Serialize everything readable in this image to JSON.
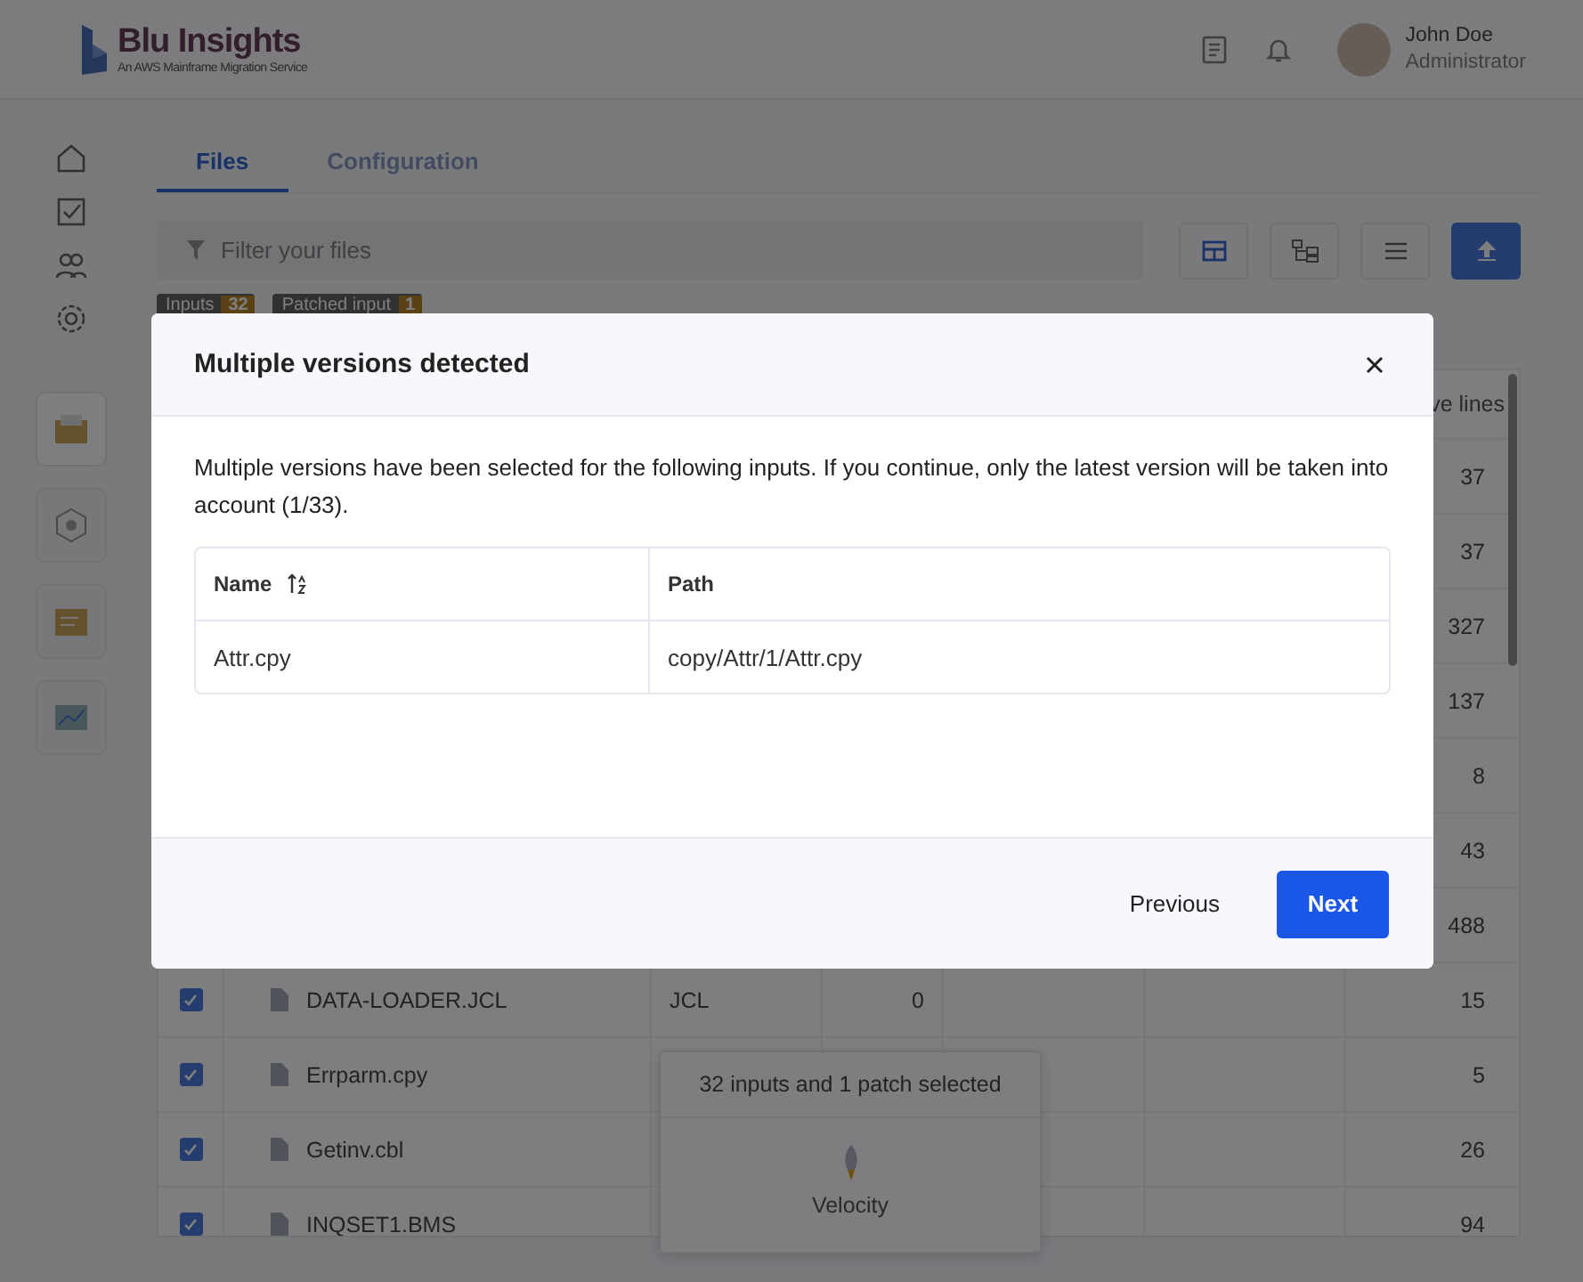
{
  "header": {
    "brand": "Blu Insights",
    "tagline": "An AWS Mainframe Migration Service",
    "user": {
      "name": "John Doe",
      "role": "Administrator"
    }
  },
  "tabs": [
    {
      "label": "Files",
      "selected": true
    },
    {
      "label": "Configuration",
      "selected": false
    }
  ],
  "filter": {
    "placeholder": "Filter your files"
  },
  "view_buttons": [
    {
      "kind": "table",
      "selected": true
    },
    {
      "kind": "tree",
      "selected": false
    }
  ],
  "badges": [
    {
      "label": "Inputs",
      "count": "32"
    },
    {
      "label": "Patched input",
      "count": "1"
    }
  ],
  "table": {
    "column_7": "ve lines",
    "rows": [
      {
        "lines": "37"
      },
      {
        "lines": "37"
      },
      {
        "lines": "327"
      },
      {
        "lines": "137"
      },
      {
        "lines": "8"
      },
      {
        "lines": "43"
      },
      {
        "lines": "488"
      },
      {
        "checked": true,
        "name": "DATA-LOADER.JCL",
        "type": "JCL",
        "count": "0",
        "lines": "15"
      },
      {
        "checked": true,
        "name": "Errparm.cpy",
        "lines": "5"
      },
      {
        "checked": true,
        "name": "Getinv.cbl",
        "lines": "26"
      },
      {
        "checked": true,
        "name": "INQSET1.BMS",
        "lines": "94"
      }
    ]
  },
  "selection_popup": {
    "summary": "32 inputs and 1 patch selected",
    "action": "Velocity"
  },
  "modal": {
    "title": "Multiple versions detected",
    "message": "Multiple versions have been selected for the following inputs. If you continue, only the latest version will be taken into account (1/33).",
    "columns": [
      "Name",
      "Path"
    ],
    "rows": [
      {
        "name": "Attr.cpy",
        "path": "copy/Attr/1/Attr.cpy"
      }
    ],
    "buttons": [
      {
        "label": "Previous",
        "kind": "secondary"
      },
      {
        "label": "Next",
        "kind": "primary"
      }
    ]
  }
}
